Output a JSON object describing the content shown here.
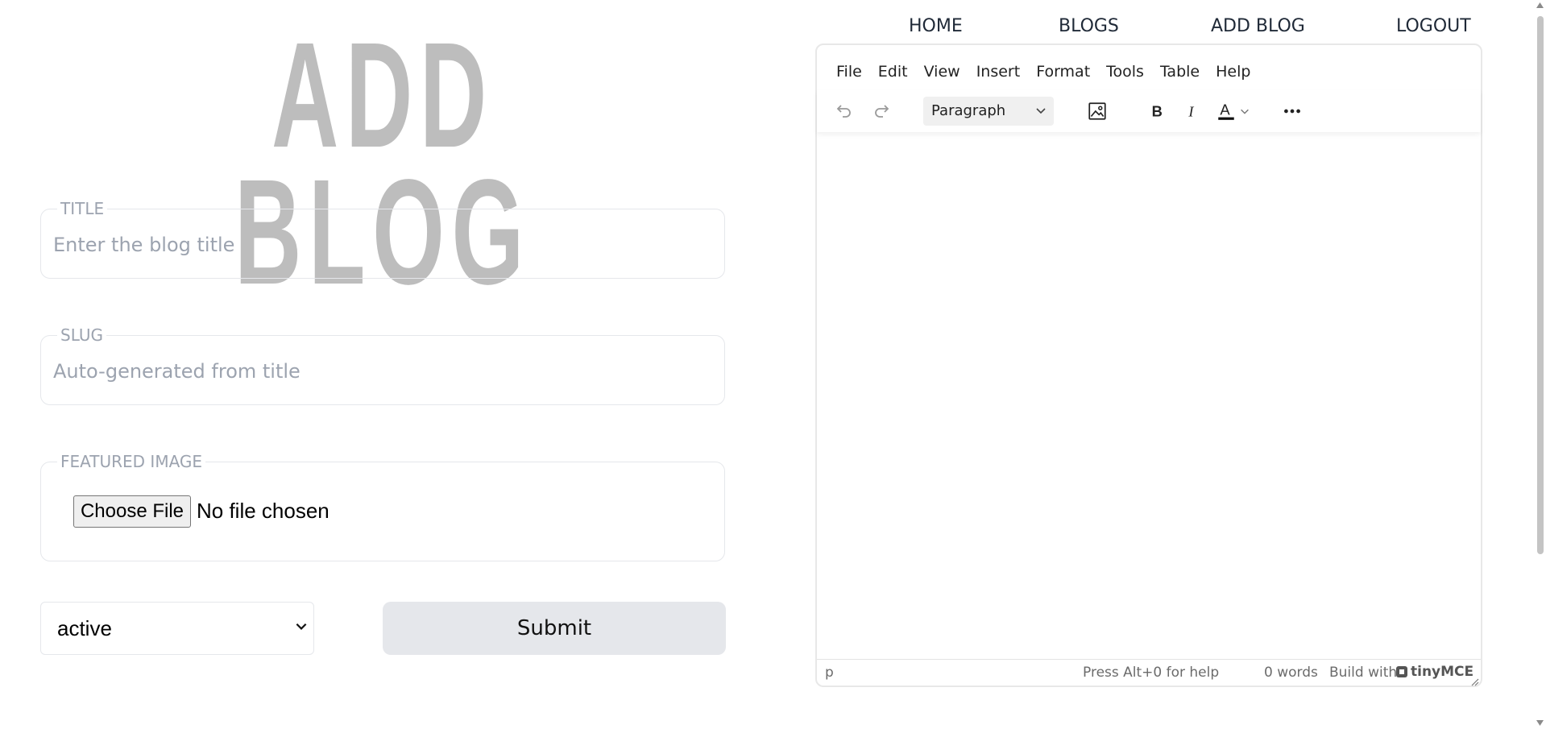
{
  "page": {
    "heading": "ADD BLOG"
  },
  "nav": {
    "home": "HOME",
    "blogs": "BLOGS",
    "add_blog": "ADD BLOG",
    "logout": "LOGOUT"
  },
  "form": {
    "title": {
      "legend": "TITLE",
      "placeholder": "Enter the blog title"
    },
    "slug": {
      "legend": "SLUG",
      "placeholder": "Auto-generated from title"
    },
    "featured_image": {
      "legend": "FEATURED IMAGE",
      "button": "Choose File",
      "status": "No file chosen"
    },
    "status_select": {
      "value": "active"
    },
    "submit": "Submit"
  },
  "editor": {
    "menus": [
      "File",
      "Edit",
      "View",
      "Insert",
      "Format",
      "Tools",
      "Table",
      "Help"
    ],
    "block_format": "Paragraph",
    "icons": [
      "undo-icon",
      "redo-icon",
      "image-icon",
      "bold-icon",
      "italic-icon",
      "text-color-icon",
      "more-icon"
    ],
    "status": {
      "path": "p",
      "help": "Press Alt+0 for help",
      "words": "0 words",
      "brand_prefix": "Build with",
      "brand": "tinyMCE"
    }
  }
}
